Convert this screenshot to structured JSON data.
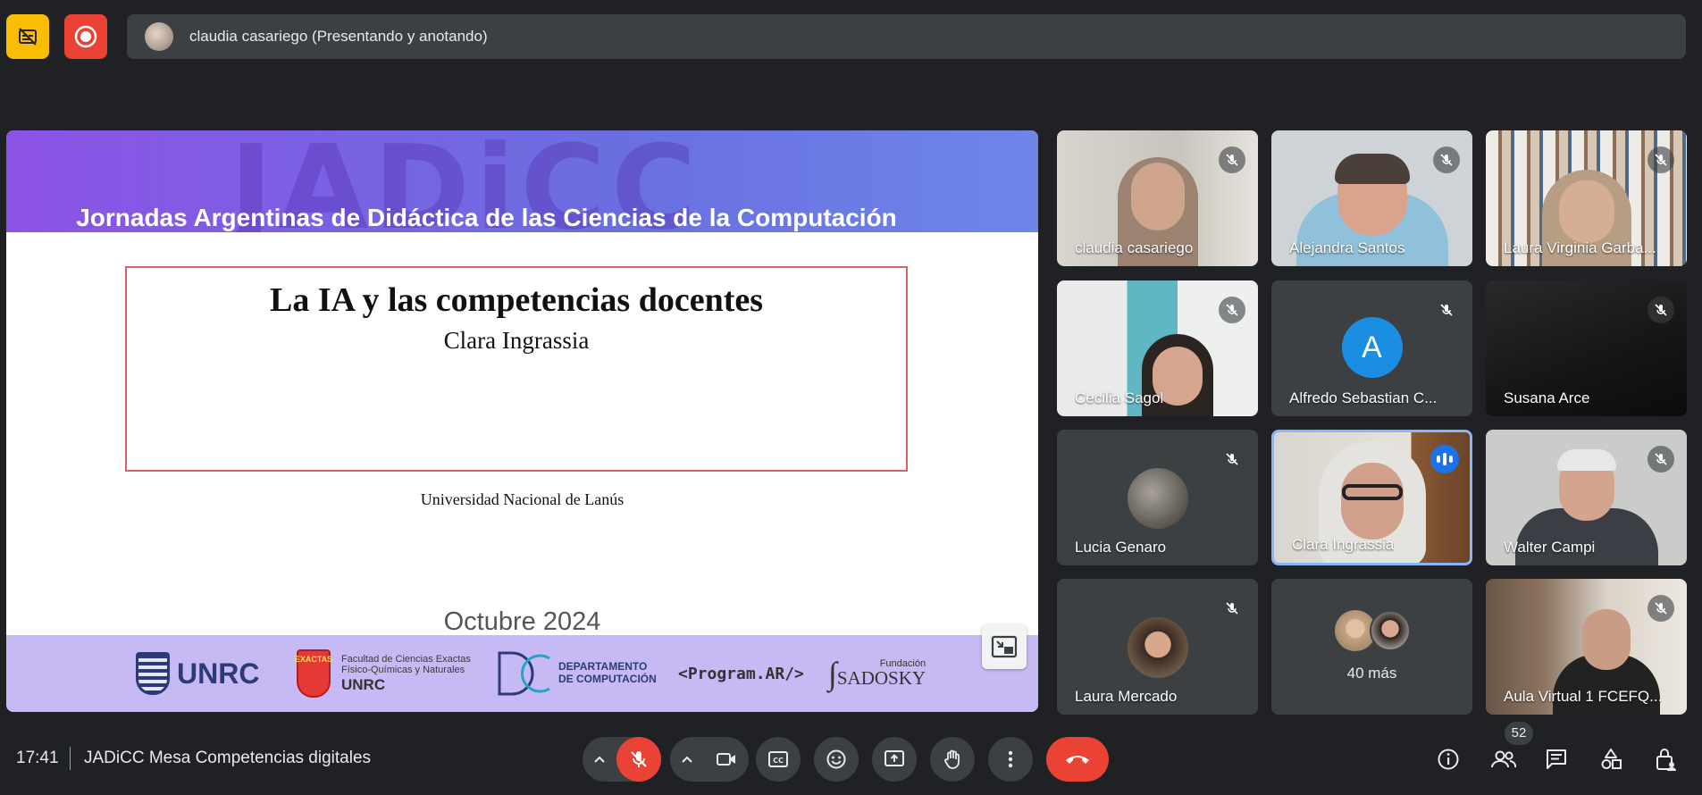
{
  "topbar": {
    "presenter_text": "claudia casariego (Presentando y anotando)"
  },
  "slide": {
    "watermark": "JADiCC",
    "event_title": "Jornadas Argentinas de Didáctica de las Ciencias de la Computación",
    "talk_title": "La IA y las competencias docentes",
    "author": "Clara Ingrassia",
    "university": "Universidad Nacional de Lanús",
    "date": "Octubre 2024",
    "logos": {
      "unrc": "UNRC",
      "exactas_shield": "EXACTAS",
      "exactas_line1": "Facultad de Ciencias Exactas",
      "exactas_line2": "Físico-Químicas y Naturales",
      "exactas_unrc": "UNRC",
      "dc_line1": "DEPARTAMENTO",
      "dc_line2": "DE COMPUTACIÓN",
      "programar": "<Program.AR/>",
      "sadosky_small": "Fundación",
      "sadosky": "SADOSKY"
    }
  },
  "participants": [
    {
      "name": "claudia casariego"
    },
    {
      "name": "Alejandra Santos"
    },
    {
      "name": "Laura Virginia Garba..."
    },
    {
      "name": "Cecilia Sagol"
    },
    {
      "name": "Alfredo Sebastian C...",
      "initial": "A"
    },
    {
      "name": "Susana Arce"
    },
    {
      "name": "Lucia Genaro"
    },
    {
      "name": "Clara Ingrassia"
    },
    {
      "name": "Walter Campi"
    },
    {
      "name": "Laura Mercado"
    },
    {
      "name": "40 más"
    },
    {
      "name": "Aula Virtual 1 FCEFQ..."
    }
  ],
  "bottombar": {
    "time": "17:41",
    "meeting_name": "JADiCC Mesa Competencias digitales",
    "participant_count": "52"
  },
  "colors": {
    "background": "#202124",
    "tile": "#3c4043",
    "danger": "#ea4335",
    "accent": "#8ab4f8",
    "warning": "#fbbc04"
  }
}
